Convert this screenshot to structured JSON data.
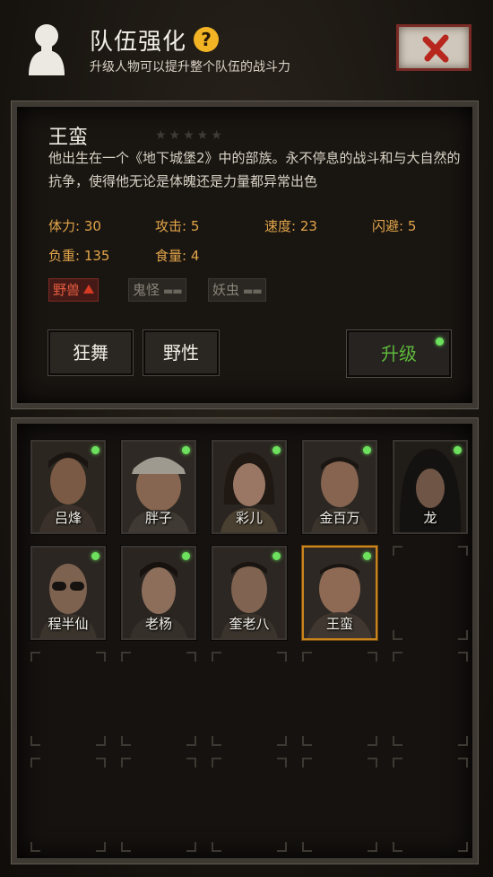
{
  "header": {
    "title": "队伍强化",
    "help_icon": "?",
    "subtitle": "升级人物可以提升整个队伍的战斗力",
    "close_icon": "close-x-icon"
  },
  "character": {
    "name": "王蛮",
    "stars": "★★★★★",
    "star_rating": 0,
    "description": "他出生在一个《地下城堡2》中的部族。永不停息的战斗和与大自然的抗争，使得他无论是体魄还是力量都异常出色",
    "stats": {
      "hp": "体力: 30",
      "attack": "攻击: 5",
      "speed": "速度: 23",
      "dodge": "闪避: 5",
      "load": "负重: 135",
      "food": "食量: 4"
    },
    "traits": [
      {
        "label": "野兽",
        "state": "up"
      },
      {
        "label": "鬼怪",
        "state": "none"
      },
      {
        "label": "妖虫",
        "state": "none"
      }
    ],
    "skills": [
      "狂舞",
      "野性"
    ],
    "upgrade_label": "升级"
  },
  "roster": [
    {
      "name": "吕烽",
      "selected": false,
      "upgradable": true
    },
    {
      "name": "胖子",
      "selected": false,
      "upgradable": true
    },
    {
      "name": "彩儿",
      "selected": false,
      "upgradable": true
    },
    {
      "name": "金百万",
      "selected": false,
      "upgradable": true
    },
    {
      "name": "龙",
      "selected": false,
      "upgradable": true
    },
    {
      "name": "程半仙",
      "selected": false,
      "upgradable": true
    },
    {
      "name": "老杨",
      "selected": false,
      "upgradable": true
    },
    {
      "name": "奎老八",
      "selected": false,
      "upgradable": true
    },
    {
      "name": "王蛮",
      "selected": true,
      "upgradable": true
    }
  ],
  "colors": {
    "accent_stat": "#e2a54a",
    "upgrade_green": "#5fb83c",
    "indicator_green": "#6de05d",
    "selected_border": "#c9841c",
    "trait_active": "#e25a3f"
  }
}
